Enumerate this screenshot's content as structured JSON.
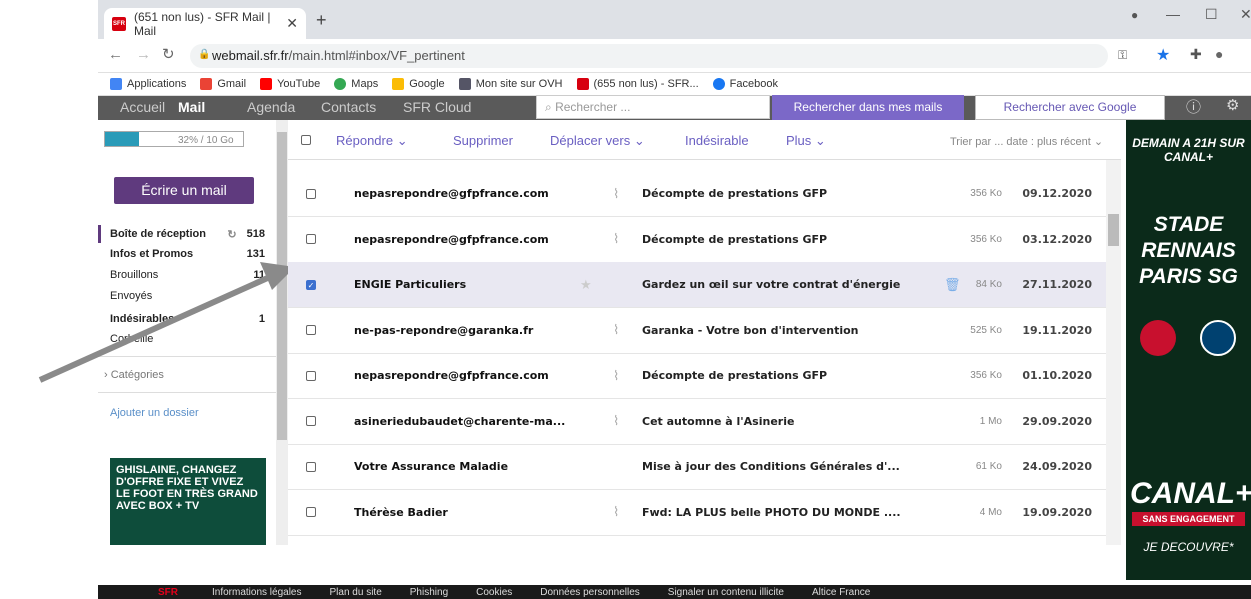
{
  "browser": {
    "tab_title": "(651 non lus) - SFR Mail | Mail",
    "url_domain": "webmail.sfr.fr",
    "url_path": "/main.html#inbox/VF_pertinent",
    "bookmarks": [
      "Applications",
      "Gmail",
      "YouTube",
      "Maps",
      "Google",
      "Mon site sur OVH",
      "(655 non lus) - SFR...",
      "Facebook"
    ]
  },
  "nav": {
    "items": [
      "Accueil",
      "Mail",
      "Agenda",
      "Contacts",
      "SFR Cloud"
    ],
    "search_placeholder": "Rechercher ...",
    "search_mail_btn": "Rechercher dans mes mails",
    "search_google_btn": "Rechercher avec Google"
  },
  "sidebar": {
    "quota": "32% / 10 Go",
    "quota_fraction": 0.32,
    "write_btn": "Écrire un mail",
    "folders": [
      {
        "name": "Boîte de réception",
        "count": "518"
      },
      {
        "name": "Infos et Promos",
        "count": "131"
      },
      {
        "name": "Brouillons",
        "count": "11"
      },
      {
        "name": "Envoyés",
        "count": ""
      },
      {
        "name": "Indésirables",
        "count": "1"
      },
      {
        "name": "Corbeille",
        "count": ""
      }
    ],
    "categories": "Catégories",
    "add_folder": "Ajouter un dossier",
    "promo": "GHISLAINE, CHANGEZ D'OFFRE FIXE ET VIVEZ LE FOOT EN TRÈS GRAND AVEC BOX + TV"
  },
  "toolbar": {
    "reply": "Répondre",
    "delete": "Supprimer",
    "move": "Déplacer vers",
    "junk": "Indésirable",
    "more": "Plus",
    "sort": "Trier par ... date : plus récent"
  },
  "emails": [
    {
      "from": "nepasrepondre@gfpfrance.com",
      "subject": "Décompte de prestations GFP",
      "size": "356 Ko",
      "date": "09.12.2020",
      "attach": true,
      "selected": false
    },
    {
      "from": "nepasrepondre@gfpfrance.com",
      "subject": "Décompte de prestations GFP",
      "size": "356 Ko",
      "date": "03.12.2020",
      "attach": true,
      "selected": false
    },
    {
      "from": "ENGIE Particuliers",
      "subject": "Gardez un œil sur votre contrat d'énergie",
      "size": "84 Ko",
      "date": "27.11.2020",
      "attach": false,
      "selected": true
    },
    {
      "from": "ne-pas-repondre@garanka.fr",
      "subject": "Garanka - Votre bon d'intervention",
      "size": "525 Ko",
      "date": "19.11.2020",
      "attach": true,
      "selected": false
    },
    {
      "from": "nepasrepondre@gfpfrance.com",
      "subject": "Décompte de prestations GFP",
      "size": "356 Ko",
      "date": "01.10.2020",
      "attach": true,
      "selected": false
    },
    {
      "from": "asineriedubaudet@charente-ma...",
      "subject": "Cet automne à l'Asinerie",
      "size": "1 Mo",
      "date": "29.09.2020",
      "attach": true,
      "selected": false
    },
    {
      "from": "Votre Assurance Maladie",
      "subject": "Mise à jour des Conditions Générales d'...",
      "size": "61 Ko",
      "date": "24.09.2020",
      "attach": false,
      "selected": false
    },
    {
      "from": "Thérèse Badier",
      "subject": "Fwd: LA PLUS belle PHOTO DU MONDE ....",
      "size": "4 Mo",
      "date": "19.09.2020",
      "attach": true,
      "selected": false
    }
  ],
  "ad": {
    "line1": "DEMAIN A 21H SUR CANAL+",
    "line2": "STADE RENNAIS PARIS SG",
    "brand": "CANAL+",
    "tag": "SANS ENGAGEMENT",
    "cta": "JE DECOUVRE*"
  },
  "footer": [
    "SFR",
    "Informations légales",
    "Plan du site",
    "Phishing",
    "Cookies",
    "Données personnelles",
    "Signaler un contenu illicite",
    "Altice France"
  ]
}
